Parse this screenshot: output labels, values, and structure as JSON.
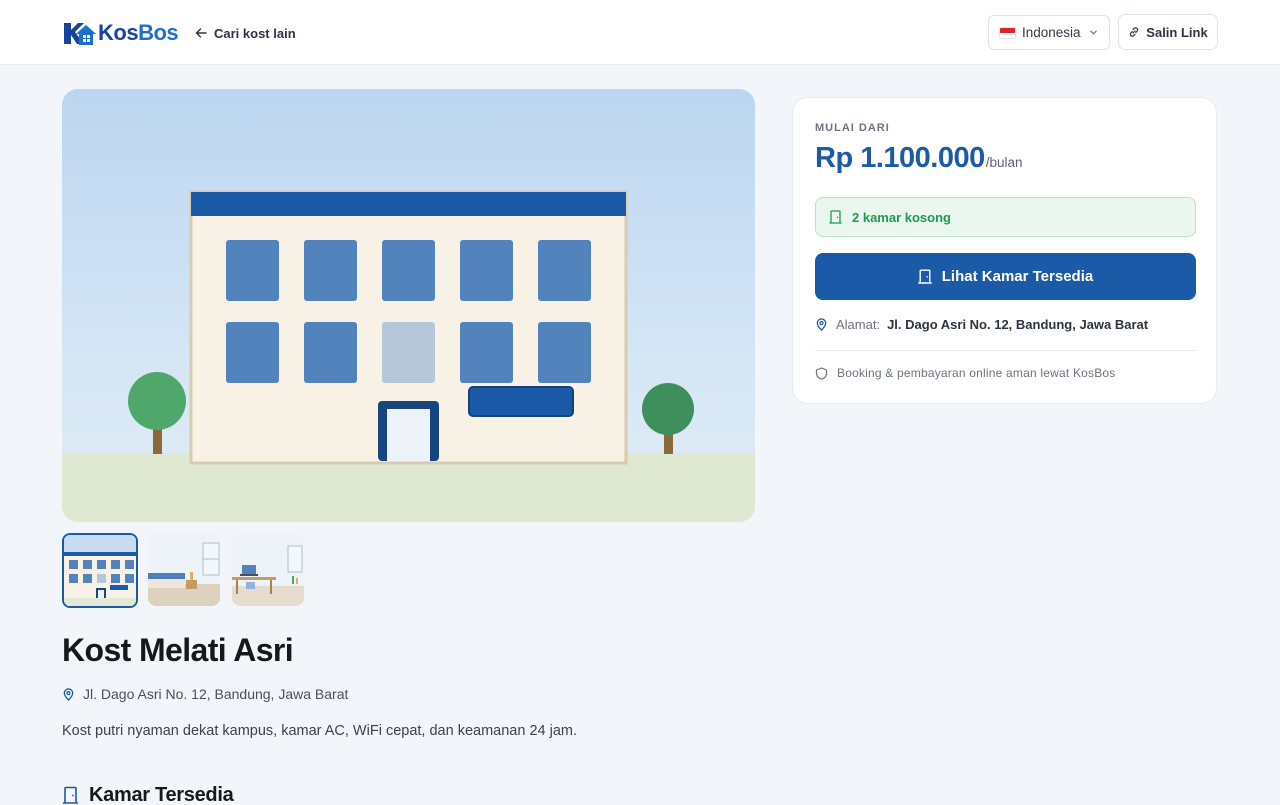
{
  "header": {
    "logo_part1": "Kos",
    "logo_part2": "Bos",
    "back_label": "Cari kost lain",
    "language": "Indonesia",
    "copy_label": "Salin Link"
  },
  "kost": {
    "name": "Kost Melati Asri",
    "address": "Jl. Dago Asri No. 12, Bandung, Jawa Barat",
    "description": "Kost putri nyaman dekat kampus, kamar AC, WiFi cepat, dan keamanan 24 jam."
  },
  "rooms_section": {
    "title": "Kamar Tersedia"
  },
  "booking": {
    "starting_label": "MULAI DARI",
    "price": "Rp 1.100.000",
    "per": "/bulan",
    "availability": "2 kamar kosong",
    "cta": "Lihat Kamar Tersedia",
    "address_label": "Alamat:",
    "address_value": "Jl. Dago Asri No. 12, Bandung, Jawa Barat",
    "secure_note": "Booking & pembayaran online aman lewat KosBos"
  },
  "gallery": {
    "selected_index": 0,
    "count": 3
  },
  "colors": {
    "brand_primary": "#1a5aa6",
    "brand_dark": "#17449a",
    "success": "#1f9a52",
    "success_bg": "#e9f7ee",
    "page_bg": "#f2f5fa"
  },
  "icons": {
    "back": "arrow-left-icon",
    "flag": "indonesia-flag-icon",
    "chevron": "chevron-down-icon",
    "copy": "link-icon",
    "location": "map-pin-icon",
    "door": "door-icon",
    "shield": "shield-icon"
  }
}
